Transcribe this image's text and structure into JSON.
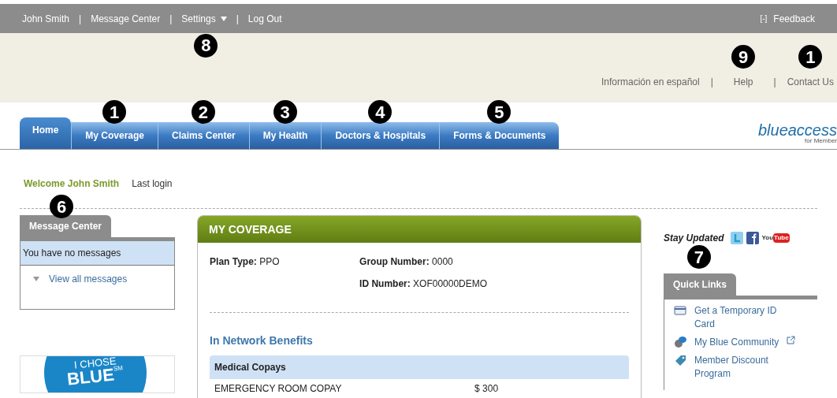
{
  "top_bar": {
    "links": [
      {
        "label": "John Smith"
      },
      {
        "label": "Message Center"
      },
      {
        "label": "Settings",
        "dropdown": true,
        "callout": "8"
      },
      {
        "label": "Log Out"
      }
    ],
    "separator": "|",
    "collapse": "[-]",
    "feedback": "Feedback"
  },
  "utility_separator": "|",
  "utility_links": [
    {
      "label": "Información en español"
    },
    {
      "label": "Help",
      "callout": "9"
    },
    {
      "label": "Contact Us",
      "callout": "1"
    }
  ],
  "tabs": [
    {
      "label": "Home",
      "selected": true
    },
    {
      "label": "My Coverage",
      "selected": false,
      "callout": "1"
    },
    {
      "label": "Claims Center",
      "selected": false,
      "callout": "2"
    },
    {
      "label": "My Health",
      "selected": false,
      "callout": "3"
    },
    {
      "label": "Doctors & Hospitals",
      "selected": false,
      "callout": "4"
    },
    {
      "label": "Forms & Documents",
      "selected": false,
      "callout": "5"
    }
  ],
  "logo": {
    "name": "blueaccess",
    "tagline": "for Member"
  },
  "welcome": {
    "greeting": "Welcome John Smith",
    "last_login": "Last login"
  },
  "message_center": {
    "title": "Message Center",
    "callout": "6",
    "status": "You have no messages",
    "link": "View all messages"
  },
  "badge": {
    "line1": "I CHOSE",
    "line2": "BLUE",
    "mark": "SM"
  },
  "coverage": {
    "title": "MY COVERAGE",
    "fields": [
      {
        "label": "Plan Type:",
        "value": "PPO"
      },
      {
        "label": "Group Number:",
        "value": "0000"
      },
      {
        "label": "ID Number:",
        "value": "XOF00000DEMO"
      }
    ],
    "section": "In Network Benefits",
    "table_header": "Medical Copays",
    "rows": [
      {
        "name": "EMERGENCY ROOM COPAY",
        "amount": "$ 300"
      }
    ]
  },
  "social": {
    "label": "Stay Updated",
    "youtube": [
      "You",
      "Tube"
    ]
  },
  "quick_links": {
    "title": "Quick Links",
    "callout": "7",
    "items": [
      {
        "kind": "card",
        "label": "Get a Temporary ID Card",
        "external": false
      },
      {
        "kind": "globe",
        "label": "My Blue Community",
        "external": true
      },
      {
        "kind": "tag",
        "label": "Member Discount Program",
        "external": false
      }
    ]
  }
}
